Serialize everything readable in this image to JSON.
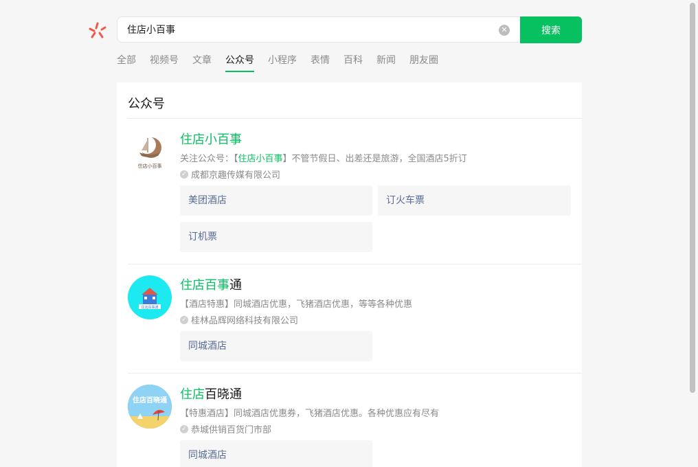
{
  "search": {
    "value": "住店小百事",
    "button_label": "搜索"
  },
  "tabs": [
    {
      "label": "全部"
    },
    {
      "label": "视频号"
    },
    {
      "label": "文章"
    },
    {
      "label": "公众号",
      "active": true
    },
    {
      "label": "小程序"
    },
    {
      "label": "表情"
    },
    {
      "label": "百科"
    },
    {
      "label": "新闻"
    },
    {
      "label": "朋友圈"
    }
  ],
  "section": {
    "title": "公众号"
  },
  "results": [
    {
      "title_highlight": "住店小百事",
      "title_rest": "",
      "desc_prefix": "关注公众号：【",
      "desc_highlight": "住店小百事",
      "desc_suffix": "】不管节假日、出差还是旅游，全国酒店5折订",
      "company": "成都京趣传媒有限公司",
      "avatar_text": "住店小百事",
      "menu": [
        "美团酒店",
        "订火车票",
        "订机票"
      ]
    },
    {
      "title_highlight": "住店百事",
      "title_rest": "通",
      "desc": "【酒店特惠】同城酒店优惠，飞猪酒店优惠，等等各种优惠",
      "company": "桂林品辉网络科技有限公司",
      "avatar_text": "住店百事通",
      "menu": [
        "同城酒店"
      ]
    },
    {
      "title_highlight": "住店",
      "title_rest": "百晓通",
      "desc": "【特惠酒店】同城酒店优惠券，飞猪酒店优惠。各种优惠应有尽有",
      "company": "恭城供销百货门市部",
      "avatar_text": "住店百晓通",
      "menu": [
        "同城酒店"
      ]
    }
  ],
  "colors": {
    "accent": "#07c160",
    "link": "#576b95",
    "avatar2_bg": "#1de9f0",
    "avatar3_bg": "#3aa7e0"
  }
}
